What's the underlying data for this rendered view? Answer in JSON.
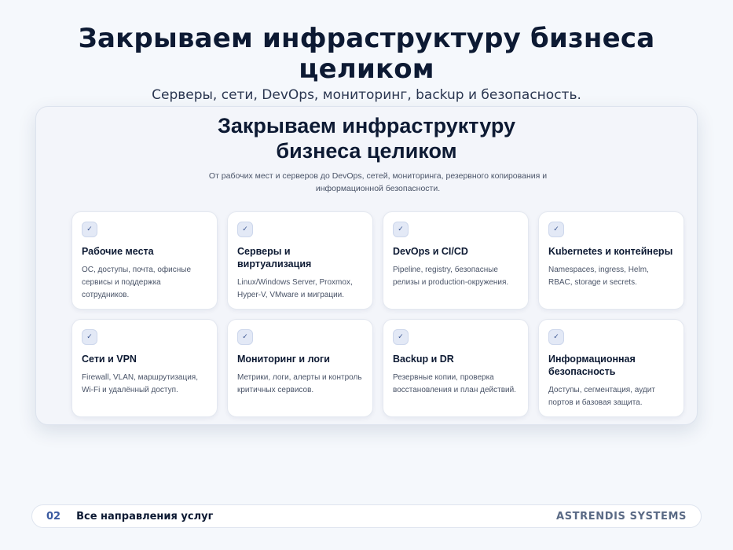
{
  "hero": {
    "title": "Закрываем инфраструктуру бизнеса целиком",
    "subtitle": "Серверы, сети, DevOps, мониторинг, backup и безопасность."
  },
  "panel": {
    "title_line1": "Закрываем инфраструктуру",
    "title_line2": "бизнеса целиком",
    "subtitle": "От рабочих мест и серверов до DevOps, сетей, мониторинга, резервного копирования и информационной безопасности."
  },
  "cards": [
    {
      "check": "✓",
      "title": "Рабочие места",
      "desc": "ОС, доступы, почта, офисные сервисы и поддержка сотрудников."
    },
    {
      "check": "✓",
      "title": "Серверы и виртуализация",
      "desc": "Linux/Windows Server, Proxmox, Hyper-V, VMware и миграции."
    },
    {
      "check": "✓",
      "title": "DevOps и CI/CD",
      "desc": "Pipeline, registry, безопасные релизы и production-окружения."
    },
    {
      "check": "✓",
      "title": "Kubernetes и контейнеры",
      "desc": "Namespaces, ingress, Helm, RBAC, storage и secrets."
    },
    {
      "check": "✓",
      "title": "Сети и VPN",
      "desc": "Firewall, VLAN, маршрутизация, Wi-Fi и удалённый доступ."
    },
    {
      "check": "✓",
      "title": "Мониторинг и логи",
      "desc": "Метрики, логи, алерты и контроль критичных сервисов."
    },
    {
      "check": "✓",
      "title": "Backup и DR",
      "desc": "Резервные копии, проверка восстановления и план действий."
    },
    {
      "check": "✓",
      "title": "Информационная безопасность",
      "desc": "Доступы, сегментация, аудит портов и базовая защита."
    }
  ],
  "footer": {
    "page_number": "02",
    "section_label": "Все направления услуг",
    "brand": "ASTRENDIS SYSTEMS"
  }
}
